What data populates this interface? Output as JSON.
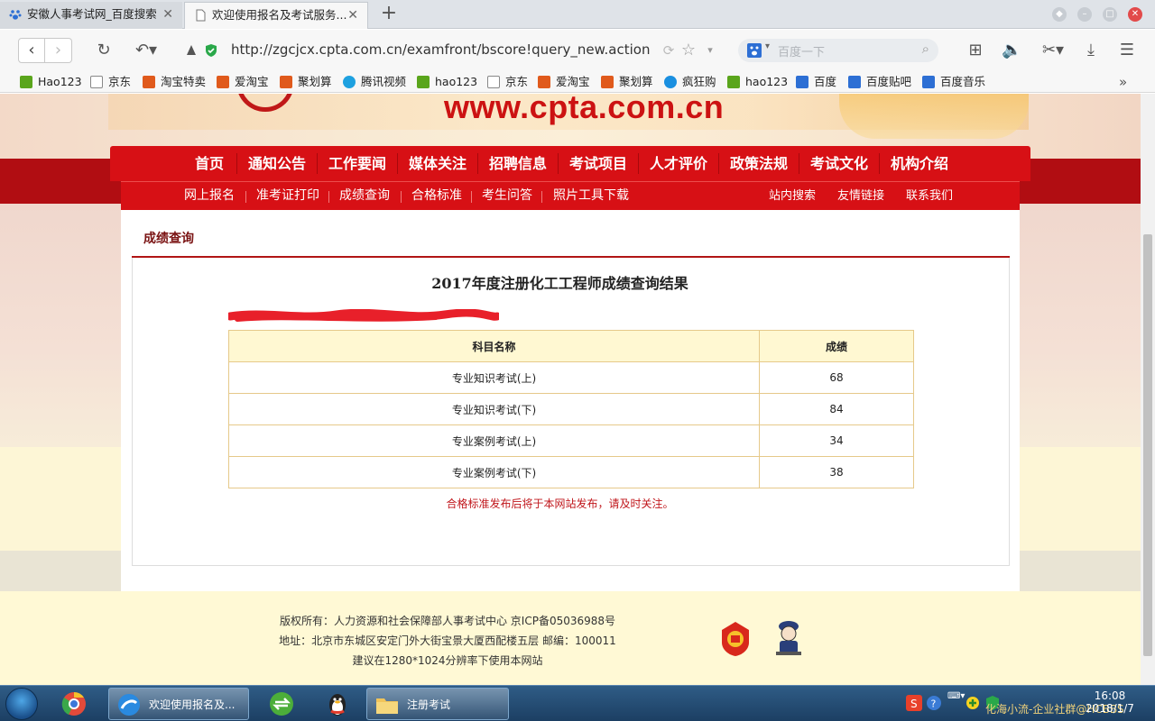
{
  "browser": {
    "tabs": [
      {
        "title": "安徽人事考试网_百度搜索",
        "active": false
      },
      {
        "title": "欢迎使用报名及考试服务...",
        "active": true
      }
    ],
    "url": "http://zgcjcx.cpta.com.cn/examfront/bscore!query_new.action",
    "search_placeholder": "百度一下",
    "bookmarks": [
      "Hao123",
      "京东",
      "淘宝特卖",
      "爱淘宝",
      "聚划算",
      "腾讯视频",
      "hao123",
      "京东",
      "爱淘宝",
      "聚划算",
      "疯狂购",
      "hao123",
      "百度",
      "百度贴吧",
      "百度音乐"
    ]
  },
  "site": {
    "banner_url": "www.cpta.com.cn",
    "main_nav": [
      "首页",
      "通知公告",
      "工作要闻",
      "媒体关注",
      "招聘信息",
      "考试项目",
      "人才评价",
      "政策法规",
      "考试文化",
      "机构介绍"
    ],
    "sub_nav_left": [
      "网上报名",
      "准考证打印",
      "成绩查询",
      "合格标准",
      "考生问答",
      "照片工具下载"
    ],
    "sub_nav_right": [
      "站内搜索",
      "友情链接",
      "联系我们"
    ],
    "breadcrumb": "成绩查询",
    "result_title": "2017年度注册化工工程师成绩查询结果",
    "table": {
      "headers": [
        "科目名称",
        "成绩"
      ],
      "rows": [
        [
          "专业知识考试(上)",
          "68"
        ],
        [
          "专业知识考试(下)",
          "84"
        ],
        [
          "专业案例考试(上)",
          "34"
        ],
        [
          "专业案例考试(下)",
          "38"
        ]
      ]
    },
    "note": "合格标准发布后将于本网站发布，请及时关注。",
    "footer": {
      "line1": "版权所有：人力资源和社会保障部人事考试中心 京ICP备05036988号",
      "line2": "地址：北京市东城区安定门外大街宝景大厦西配楼五层 邮编：100011",
      "line3": "建议在1280*1024分辨率下使用本网站"
    }
  },
  "taskbar": {
    "tasks": [
      "欢迎使用报名及...",
      "注册考试"
    ],
    "time": "16:08",
    "date": "2018/1/7",
    "watermark": "化海小流-企业社群@HCBBS"
  },
  "colors": {
    "brand_red": "#d71015",
    "table_border": "#e6c98a",
    "note_red": "#c0161b"
  }
}
